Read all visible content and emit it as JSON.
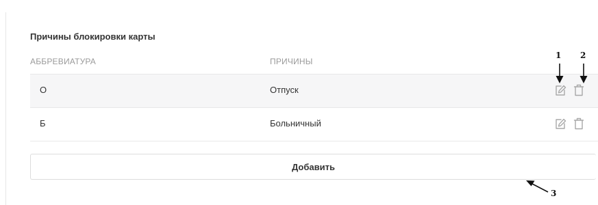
{
  "section": {
    "title": "Причины блокировки карты"
  },
  "table": {
    "columns": [
      "АББРЕВИАТУРА",
      "ПРИЧИНЫ"
    ],
    "rows": [
      {
        "abbreviation": "О",
        "reason": "Отпуск"
      },
      {
        "abbreviation": "Б",
        "reason": "Больничный"
      }
    ],
    "row_actions": [
      "edit-icon",
      "trash-icon"
    ]
  },
  "add_button": {
    "label": "Добавить"
  },
  "callouts": [
    "1",
    "2",
    "3"
  ],
  "colors": {
    "icon": "#a8a8a8",
    "row_shaded": "#f6f6f7",
    "border": "#dcdcdc",
    "annotation": "#111111"
  }
}
